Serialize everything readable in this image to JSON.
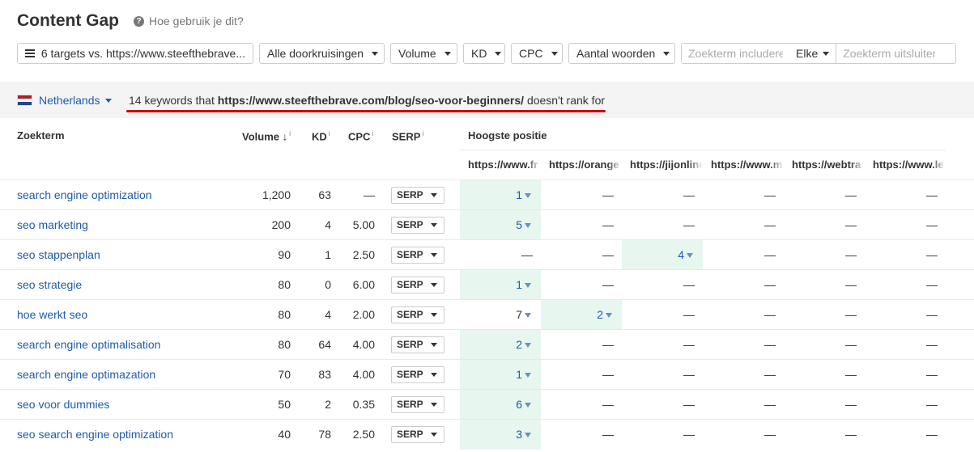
{
  "page": {
    "title": "Content Gap",
    "help_label": "Hoe gebruik je dit?"
  },
  "filters": {
    "targets": "6 targets vs. https://www.steefthebrave...",
    "intersections": "Alle doorkruisingen",
    "volume": "Volume",
    "kd": "KD",
    "cpc": "CPC",
    "word_count": "Aantal woorden",
    "include_placeholder": "Zoekterm includeren",
    "match_mode": "Elke",
    "exclude_placeholder": "Zoekterm uitsluiten"
  },
  "infobar": {
    "country": "Netherlands",
    "summary_prefix": "14 keywords that ",
    "summary_url": "https://www.steefthebrave.com/blog/seo-voor-beginners/",
    "summary_suffix": " doesn't rank for"
  },
  "colors": {
    "accent_link": "#1e5bab",
    "highlight": "#e7f6ee",
    "underline": "#cc0000"
  },
  "table": {
    "headers": {
      "keyword": "Zoekterm",
      "volume": "Volume",
      "kd": "KD",
      "cpc": "CPC",
      "serp": "SERP",
      "top_position": "Hoogste positie",
      "info_icon": "i",
      "sort_arrow": "↓"
    },
    "competitors": [
      "https://www.fr",
      "https://orange",
      "https://jijonline",
      "https://www.m",
      "https://webtra",
      "https://www.le"
    ],
    "rows": [
      {
        "keyword": "search engine optimization",
        "volume": "1,200",
        "kd": "63",
        "cpc": "—",
        "serp": "SERP",
        "positions": [
          "1",
          "—",
          "—",
          "—",
          "—",
          "—"
        ],
        "highlight": [
          true,
          false,
          false,
          false,
          false,
          false
        ]
      },
      {
        "keyword": "seo marketing",
        "volume": "200",
        "kd": "4",
        "cpc": "5.00",
        "serp": "SERP",
        "positions": [
          "5",
          "—",
          "—",
          "—",
          "—",
          "—"
        ],
        "highlight": [
          true,
          false,
          false,
          false,
          false,
          false
        ]
      },
      {
        "keyword": "seo stappenplan",
        "volume": "90",
        "kd": "1",
        "cpc": "2.50",
        "serp": "SERP",
        "positions": [
          "—",
          "—",
          "4",
          "—",
          "—",
          "—"
        ],
        "highlight": [
          false,
          false,
          true,
          false,
          false,
          false
        ]
      },
      {
        "keyword": "seo strategie",
        "volume": "80",
        "kd": "0",
        "cpc": "6.00",
        "serp": "SERP",
        "positions": [
          "1",
          "—",
          "—",
          "—",
          "—",
          "—"
        ],
        "highlight": [
          true,
          false,
          false,
          false,
          false,
          false
        ]
      },
      {
        "keyword": "hoe werkt seo",
        "volume": "80",
        "kd": "4",
        "cpc": "2.00",
        "serp": "SERP",
        "positions": [
          "7",
          "2",
          "—",
          "—",
          "—",
          "—"
        ],
        "highlight": [
          false,
          true,
          false,
          false,
          false,
          false
        ]
      },
      {
        "keyword": "search engine optimalisation",
        "volume": "80",
        "kd": "64",
        "cpc": "4.00",
        "serp": "SERP",
        "positions": [
          "2",
          "—",
          "—",
          "—",
          "—",
          "—"
        ],
        "highlight": [
          true,
          false,
          false,
          false,
          false,
          false
        ]
      },
      {
        "keyword": "search engine optimazation",
        "volume": "70",
        "kd": "83",
        "cpc": "4.00",
        "serp": "SERP",
        "positions": [
          "1",
          "—",
          "—",
          "—",
          "—",
          "—"
        ],
        "highlight": [
          true,
          false,
          false,
          false,
          false,
          false
        ]
      },
      {
        "keyword": "seo voor dummies",
        "volume": "50",
        "kd": "2",
        "cpc": "0.35",
        "serp": "SERP",
        "positions": [
          "6",
          "—",
          "—",
          "—",
          "—",
          "—"
        ],
        "highlight": [
          true,
          false,
          false,
          false,
          false,
          false
        ]
      },
      {
        "keyword": "seo search engine optimization",
        "volume": "40",
        "kd": "78",
        "cpc": "2.50",
        "serp": "SERP",
        "positions": [
          "3",
          "—",
          "—",
          "—",
          "—",
          "—"
        ],
        "highlight": [
          true,
          false,
          false,
          false,
          false,
          false
        ]
      }
    ]
  }
}
